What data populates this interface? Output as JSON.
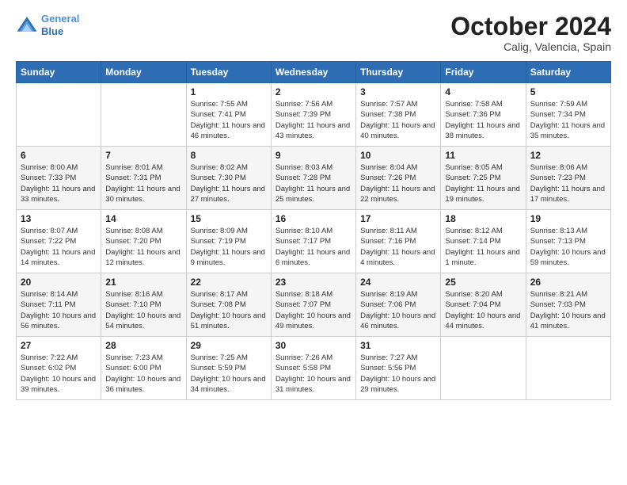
{
  "header": {
    "logo_line1": "General",
    "logo_line2": "Blue",
    "month_title": "October 2024",
    "location": "Calig, Valencia, Spain"
  },
  "weekdays": [
    "Sunday",
    "Monday",
    "Tuesday",
    "Wednesday",
    "Thursday",
    "Friday",
    "Saturday"
  ],
  "weeks": [
    [
      {
        "day": "",
        "info": ""
      },
      {
        "day": "",
        "info": ""
      },
      {
        "day": "1",
        "info": "Sunrise: 7:55 AM\nSunset: 7:41 PM\nDaylight: 11 hours and 46 minutes."
      },
      {
        "day": "2",
        "info": "Sunrise: 7:56 AM\nSunset: 7:39 PM\nDaylight: 11 hours and 43 minutes."
      },
      {
        "day": "3",
        "info": "Sunrise: 7:57 AM\nSunset: 7:38 PM\nDaylight: 11 hours and 40 minutes."
      },
      {
        "day": "4",
        "info": "Sunrise: 7:58 AM\nSunset: 7:36 PM\nDaylight: 11 hours and 38 minutes."
      },
      {
        "day": "5",
        "info": "Sunrise: 7:59 AM\nSunset: 7:34 PM\nDaylight: 11 hours and 35 minutes."
      }
    ],
    [
      {
        "day": "6",
        "info": "Sunrise: 8:00 AM\nSunset: 7:33 PM\nDaylight: 11 hours and 33 minutes."
      },
      {
        "day": "7",
        "info": "Sunrise: 8:01 AM\nSunset: 7:31 PM\nDaylight: 11 hours and 30 minutes."
      },
      {
        "day": "8",
        "info": "Sunrise: 8:02 AM\nSunset: 7:30 PM\nDaylight: 11 hours and 27 minutes."
      },
      {
        "day": "9",
        "info": "Sunrise: 8:03 AM\nSunset: 7:28 PM\nDaylight: 11 hours and 25 minutes."
      },
      {
        "day": "10",
        "info": "Sunrise: 8:04 AM\nSunset: 7:26 PM\nDaylight: 11 hours and 22 minutes."
      },
      {
        "day": "11",
        "info": "Sunrise: 8:05 AM\nSunset: 7:25 PM\nDaylight: 11 hours and 19 minutes."
      },
      {
        "day": "12",
        "info": "Sunrise: 8:06 AM\nSunset: 7:23 PM\nDaylight: 11 hours and 17 minutes."
      }
    ],
    [
      {
        "day": "13",
        "info": "Sunrise: 8:07 AM\nSunset: 7:22 PM\nDaylight: 11 hours and 14 minutes."
      },
      {
        "day": "14",
        "info": "Sunrise: 8:08 AM\nSunset: 7:20 PM\nDaylight: 11 hours and 12 minutes."
      },
      {
        "day": "15",
        "info": "Sunrise: 8:09 AM\nSunset: 7:19 PM\nDaylight: 11 hours and 9 minutes."
      },
      {
        "day": "16",
        "info": "Sunrise: 8:10 AM\nSunset: 7:17 PM\nDaylight: 11 hours and 6 minutes."
      },
      {
        "day": "17",
        "info": "Sunrise: 8:11 AM\nSunset: 7:16 PM\nDaylight: 11 hours and 4 minutes."
      },
      {
        "day": "18",
        "info": "Sunrise: 8:12 AM\nSunset: 7:14 PM\nDaylight: 11 hours and 1 minute."
      },
      {
        "day": "19",
        "info": "Sunrise: 8:13 AM\nSunset: 7:13 PM\nDaylight: 10 hours and 59 minutes."
      }
    ],
    [
      {
        "day": "20",
        "info": "Sunrise: 8:14 AM\nSunset: 7:11 PM\nDaylight: 10 hours and 56 minutes."
      },
      {
        "day": "21",
        "info": "Sunrise: 8:16 AM\nSunset: 7:10 PM\nDaylight: 10 hours and 54 minutes."
      },
      {
        "day": "22",
        "info": "Sunrise: 8:17 AM\nSunset: 7:08 PM\nDaylight: 10 hours and 51 minutes."
      },
      {
        "day": "23",
        "info": "Sunrise: 8:18 AM\nSunset: 7:07 PM\nDaylight: 10 hours and 49 minutes."
      },
      {
        "day": "24",
        "info": "Sunrise: 8:19 AM\nSunset: 7:06 PM\nDaylight: 10 hours and 46 minutes."
      },
      {
        "day": "25",
        "info": "Sunrise: 8:20 AM\nSunset: 7:04 PM\nDaylight: 10 hours and 44 minutes."
      },
      {
        "day": "26",
        "info": "Sunrise: 8:21 AM\nSunset: 7:03 PM\nDaylight: 10 hours and 41 minutes."
      }
    ],
    [
      {
        "day": "27",
        "info": "Sunrise: 7:22 AM\nSunset: 6:02 PM\nDaylight: 10 hours and 39 minutes."
      },
      {
        "day": "28",
        "info": "Sunrise: 7:23 AM\nSunset: 6:00 PM\nDaylight: 10 hours and 36 minutes."
      },
      {
        "day": "29",
        "info": "Sunrise: 7:25 AM\nSunset: 5:59 PM\nDaylight: 10 hours and 34 minutes."
      },
      {
        "day": "30",
        "info": "Sunrise: 7:26 AM\nSunset: 5:58 PM\nDaylight: 10 hours and 31 minutes."
      },
      {
        "day": "31",
        "info": "Sunrise: 7:27 AM\nSunset: 5:56 PM\nDaylight: 10 hours and 29 minutes."
      },
      {
        "day": "",
        "info": ""
      },
      {
        "day": "",
        "info": ""
      }
    ]
  ]
}
